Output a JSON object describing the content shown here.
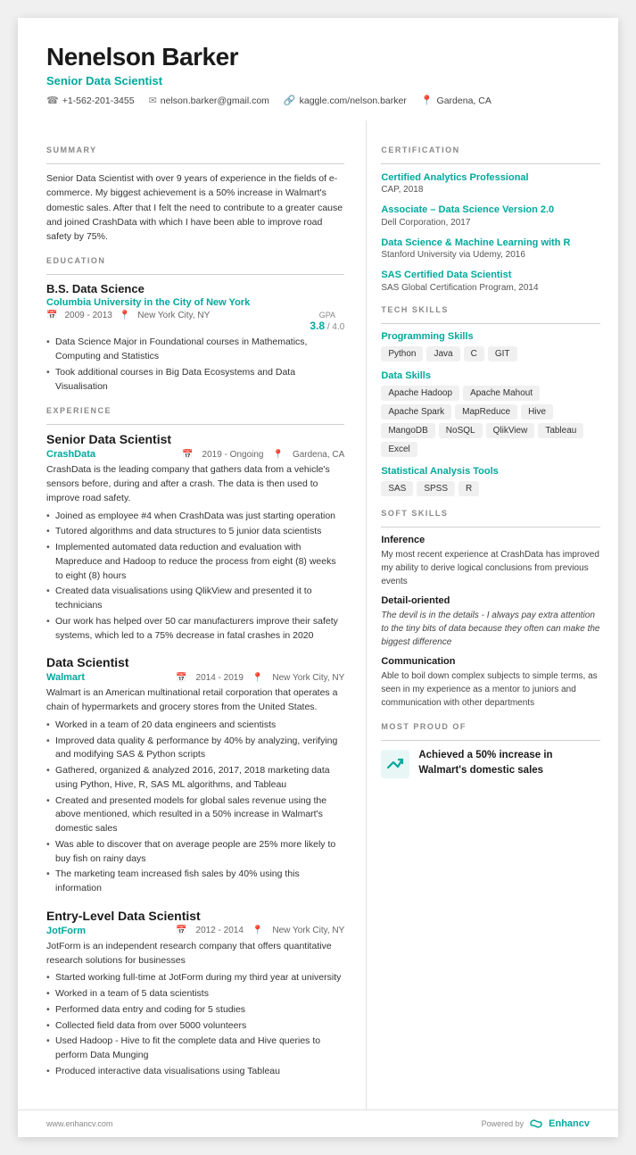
{
  "header": {
    "name": "Nenelson Barker",
    "title": "Senior Data Scientist",
    "phone": "+1-562-201-3455",
    "email": "nelson.barker@gmail.com",
    "kaggle": "kaggle.com/nelson.barker",
    "location": "Gardena, CA"
  },
  "summary": {
    "title": "SUMMARY",
    "text": "Senior Data Scientist with over 9 years of experience in the fields of e-commerce. My biggest achievement is a 50% increase in Walmart's domestic sales. After that I felt the need to contribute to a greater cause and joined CrashData with which I have been able to improve road safety by 75%."
  },
  "education": {
    "title": "EDUCATION",
    "degree": "B.S. Data Science",
    "school": "Columbia University in the City of New York",
    "dates": "2009 - 2013",
    "location": "New York City, NY",
    "gpa_label": "GPA",
    "gpa_value": "3.8",
    "gpa_max": "4.0",
    "bullets": [
      "Data Science Major in Foundational courses in Mathematics, Computing and Statistics",
      "Took additional courses in Big Data Ecosystems and Data Visualisation"
    ]
  },
  "experience": {
    "title": "EXPERIENCE",
    "jobs": [
      {
        "role": "Senior Data Scientist",
        "company": "CrashData",
        "dates": "2019 - Ongoing",
        "location": "Gardena, CA",
        "description": "CrashData is the leading company that gathers data from a vehicle's sensors before, during and after a crash. The data is then used to improve road safety.",
        "bullets": [
          "Joined as employee #4 when CrashData was just starting operation",
          "Tutored algorithms and data structures to 5 junior data scientists",
          "Implemented automated data reduction and evaluation with Mapreduce and Hadoop to reduce the process from eight (8) weeks to eight (8) hours",
          "Created data visualisations using QlikView and presented it to technicians",
          "Our work has helped over 50 car manufacturers improve their safety systems, which led to a 75% decrease in fatal crashes in 2020"
        ]
      },
      {
        "role": "Data Scientist",
        "company": "Walmart",
        "dates": "2014 - 2019",
        "location": "New York City, NY",
        "description": "Walmart is an American multinational retail corporation that operates a chain of hypermarkets and grocery stores from the United States.",
        "bullets": [
          "Worked in a team of 20 data engineers and scientists",
          "Improved data quality & performance by 40% by analyzing, verifying and modifying SAS & Python scripts",
          "Gathered, organized & analyzed 2016, 2017, 2018 marketing data using Python, Hive, R, SAS ML algorithms, and Tableau",
          "Created and presented models for global sales revenue using the above mentioned, which resulted in a 50% increase in Walmart's domestic sales",
          "Was able to discover that on average people are 25% more likely to buy fish on rainy days",
          "The marketing team increased fish sales by 40% using this information"
        ]
      },
      {
        "role": "Entry-Level Data Scientist",
        "company": "JotForm",
        "dates": "2012 - 2014",
        "location": "New York City, NY",
        "description": "JotForm is an independent research company that offers quantitative research solutions for businesses",
        "bullets": [
          "Started working full-time at JotForm during my third year at university",
          "Worked in a team of 5 data scientists",
          "Performed data entry and coding for 5 studies",
          "Collected field data from over 5000 volunteers",
          "Used Hadoop - Hive to fit the complete data and Hive queries to perform Data Munging",
          "Produced interactive data visualisations using Tableau"
        ]
      }
    ]
  },
  "certification": {
    "title": "CERTIFICATION",
    "items": [
      {
        "title": "Certified Analytics Professional",
        "subtitle": "CAP, 2018"
      },
      {
        "title": "Associate – Data Science Version 2.0",
        "subtitle": "Dell Corporation, 2017"
      },
      {
        "title": "Data Science & Machine Learning with R",
        "subtitle": "Stanford University via Udemy, 2016"
      },
      {
        "title": "SAS Certified Data Scientist",
        "subtitle": "SAS Global Certification Program, 2014"
      }
    ]
  },
  "tech_skills": {
    "title": "TECH SKILLS",
    "subsections": [
      {
        "label": "Programming Skills",
        "tags": [
          "Python",
          "Java",
          "C",
          "GIT"
        ]
      },
      {
        "label": "Data Skills",
        "tags": [
          "Apache Hadoop",
          "Apache Mahout",
          "Apache Spark",
          "MapReduce",
          "Hive",
          "MangoDB",
          "NoSQL",
          "QlikView",
          "Tableau",
          "Excel"
        ]
      },
      {
        "label": "Statistical Analysis Tools",
        "tags": [
          "SAS",
          "SPSS",
          "R"
        ]
      }
    ]
  },
  "soft_skills": {
    "title": "SOFT SKILLS",
    "items": [
      {
        "title": "Inference",
        "text": "My most recent experience at CrashData has improved my ability to derive logical conclusions from previous events"
      },
      {
        "title": "Detail-oriented",
        "text": "The devil is in the details - I always pay extra attention to the tiny bits of data because they often can make the biggest difference"
      },
      {
        "title": "Communication",
        "text": "Able to boil down complex subjects to simple terms, as seen in my experience as a mentor to juniors and communication with other departments"
      }
    ]
  },
  "most_proud_of": {
    "title": "MOST PROUD OF",
    "text": "Achieved a 50% increase in Walmart's domestic sales"
  },
  "footer": {
    "url": "www.enhancv.com",
    "powered_by": "Powered by",
    "brand": "Enhancv"
  }
}
